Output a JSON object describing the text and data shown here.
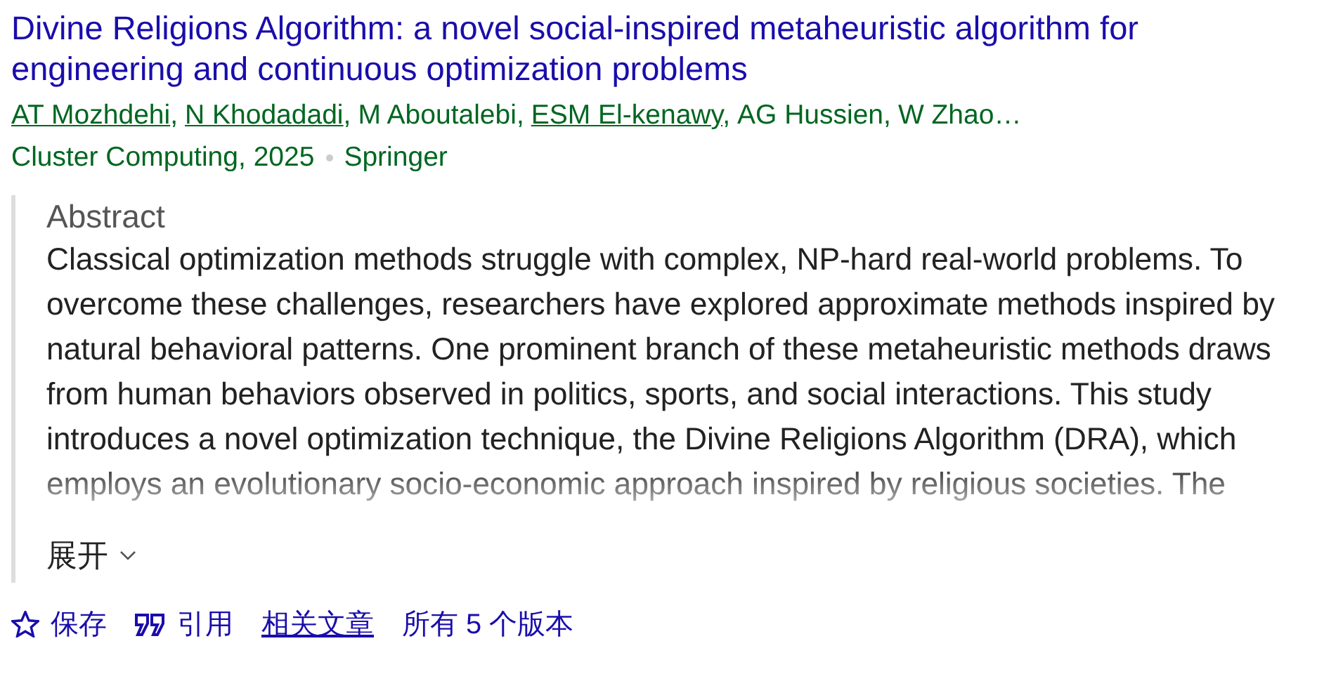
{
  "title": "Divine Religions Algorithm: a novel social-inspired metaheuristic algorithm for engineering and continuous optimization problems",
  "authors": [
    {
      "name": "AT Mozhdehi",
      "linked": true,
      "separator": ","
    },
    {
      "name": "N Khodadadi",
      "linked": true,
      "separator": ","
    },
    {
      "name": "M Aboutalebi",
      "linked": false,
      "separator": ","
    },
    {
      "name": "ESM El-kenawy",
      "linked": true,
      "separator": ","
    },
    {
      "name": "AG Hussien",
      "linked": false,
      "separator": ","
    },
    {
      "name": "W Zhao…",
      "linked": false
    }
  ],
  "source": "Cluster Computing, 2025",
  "publisher": "Springer",
  "abstract": {
    "heading": "Abstract",
    "text": "Classical optimization methods struggle with complex, NP-hard real-world problems. To overcome these challenges, researchers have explored approximate methods inspired by natural behavioral patterns. One prominent branch of these metaheuristic methods draws from human behaviors observed in politics, sports, and social interactions. This study introduces a novel optimization technique, the Divine Religions Algorithm (DRA), which employs an evolutionary socio-economic approach inspired by religious societies. The",
    "expand": "展开"
  },
  "actions": [
    {
      "kind": "save",
      "label": "保存"
    },
    {
      "kind": "cite",
      "label": "引用"
    },
    {
      "kind": "related",
      "label": "相关文章"
    },
    {
      "kind": "versions",
      "label": "所有 5 个版本"
    }
  ]
}
